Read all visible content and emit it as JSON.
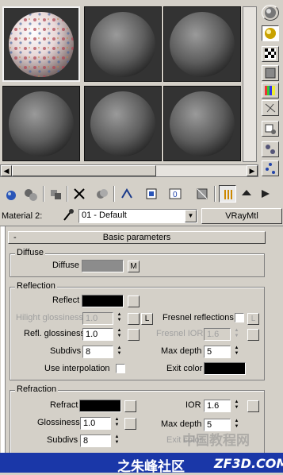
{
  "material_slots": [
    {
      "name": "slot-1",
      "kind": "textured"
    },
    {
      "name": "slot-2",
      "kind": "plain"
    },
    {
      "name": "slot-3",
      "kind": "plain"
    },
    {
      "name": "slot-4",
      "kind": "plain"
    },
    {
      "name": "slot-5",
      "kind": "plain"
    },
    {
      "name": "slot-6",
      "kind": "plain"
    }
  ],
  "side_toolbar": [
    "sample-type-sphere-icon",
    "backlight-icon",
    "checker-background-icon",
    "sample-uv-tiling-icon",
    "video-color-check-icon",
    "make-preview-icon",
    "options-icon",
    "select-by-material-icon",
    "material-map-navigator-icon"
  ],
  "top_toolbar": [
    "get-material-icon",
    "put-to-scene-icon",
    "assign-to-selection-icon",
    "reset-map-icon",
    "make-copy-icon",
    "make-unique-icon",
    "put-to-library-icon",
    "material-id-channel-icon",
    "show-map-icon",
    "show-end-result-icon",
    "go-to-parent-icon",
    "go-forward-icon"
  ],
  "material": {
    "label": "Material 2:",
    "name": "01 - Default",
    "type": "VRayMtl"
  },
  "rollout": {
    "toggle": "-",
    "title": "Basic parameters"
  },
  "diffuse": {
    "group": "Diffuse",
    "label": "Diffuse",
    "map_button": "M",
    "color": "#8c8c8c"
  },
  "reflection": {
    "group": "Reflection",
    "reflect_label": "Reflect",
    "reflect_color": "#000000",
    "hilight_label": "Hilight glossiness",
    "hilight_value": "1.0",
    "lock_label": "L",
    "fresnel_label": "Fresnel reflections",
    "fresnel_lock": "L",
    "refl_gloss_label": "Refl. glossiness",
    "refl_gloss_value": "1.0",
    "fresnel_ior_label": "Fresnel IOR",
    "fresnel_ior_value": "1.6",
    "subdivs_label": "Subdivs",
    "subdivs_value": "8",
    "max_depth_label": "Max depth",
    "max_depth_value": "5",
    "interp_label": "Use interpolation",
    "exit_label": "Exit color",
    "exit_color": "#000000"
  },
  "refraction": {
    "group": "Refraction",
    "refract_label": "Refract",
    "refract_color": "#000000",
    "ior_label": "IOR",
    "ior_value": "1.6",
    "gloss_label": "Glossiness",
    "gloss_value": "1.0",
    "max_depth_label": "Max depth",
    "max_depth_value": "5",
    "subdivs_label": "Subdivs",
    "subdivs_value": "8",
    "exit_label": "Exit color"
  },
  "footer": {
    "left": "之朱峰社区",
    "right": "ZF3D.COM"
  },
  "watermark": "中国教程网"
}
